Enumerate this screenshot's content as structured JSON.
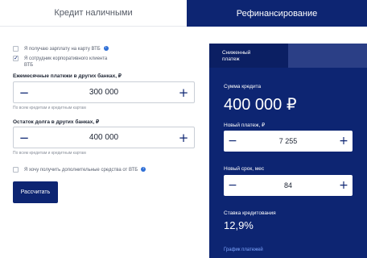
{
  "tabs": {
    "cash_credit": "Кредит наличными",
    "refinancing": "Рефинансирование"
  },
  "form": {
    "checkbox_salary": {
      "label": "Я получаю зарплату на карту ВТБ",
      "checked": false
    },
    "checkbox_corporate": {
      "label_line1": "Я сотрудник корпоративного клиента",
      "label_line2": "ВТБ",
      "checked": true
    },
    "monthly_payments": {
      "label": "Ежемесячные платежи в других банках, ₽",
      "value": "300 000",
      "hint": "По всем кредитам и кредитным картам"
    },
    "debt_balance": {
      "label": "Остаток долга в других банках, ₽",
      "value": "400 000",
      "hint": "По всем кредитам и кредитным картам"
    },
    "checkbox_extra_funds": {
      "label": "Я хочу получить дополнительные средства от ВТБ",
      "checked": false
    },
    "calculate_button": "Рассчитать"
  },
  "panel": {
    "mode_tab_line1": "Сниженный",
    "mode_tab_line2": "платеж",
    "credit_sum_label": "Сумма кредита",
    "credit_sum_value": "400 000 ₽",
    "new_payment_label": "Новый платеж, ₽",
    "new_payment_value": "7 255",
    "new_term_label": "Новый срок, мес",
    "new_term_value": "84",
    "rate_label": "Ставка кредитования",
    "rate_value": "12,9%",
    "schedule_link": "График платежей"
  },
  "icons": {
    "minus": "−",
    "plus": "+",
    "info": "i"
  },
  "colors": {
    "brand_navy": "#0d2572",
    "link_blue": "#7fa7ff",
    "info_blue": "#2f6fd6"
  }
}
